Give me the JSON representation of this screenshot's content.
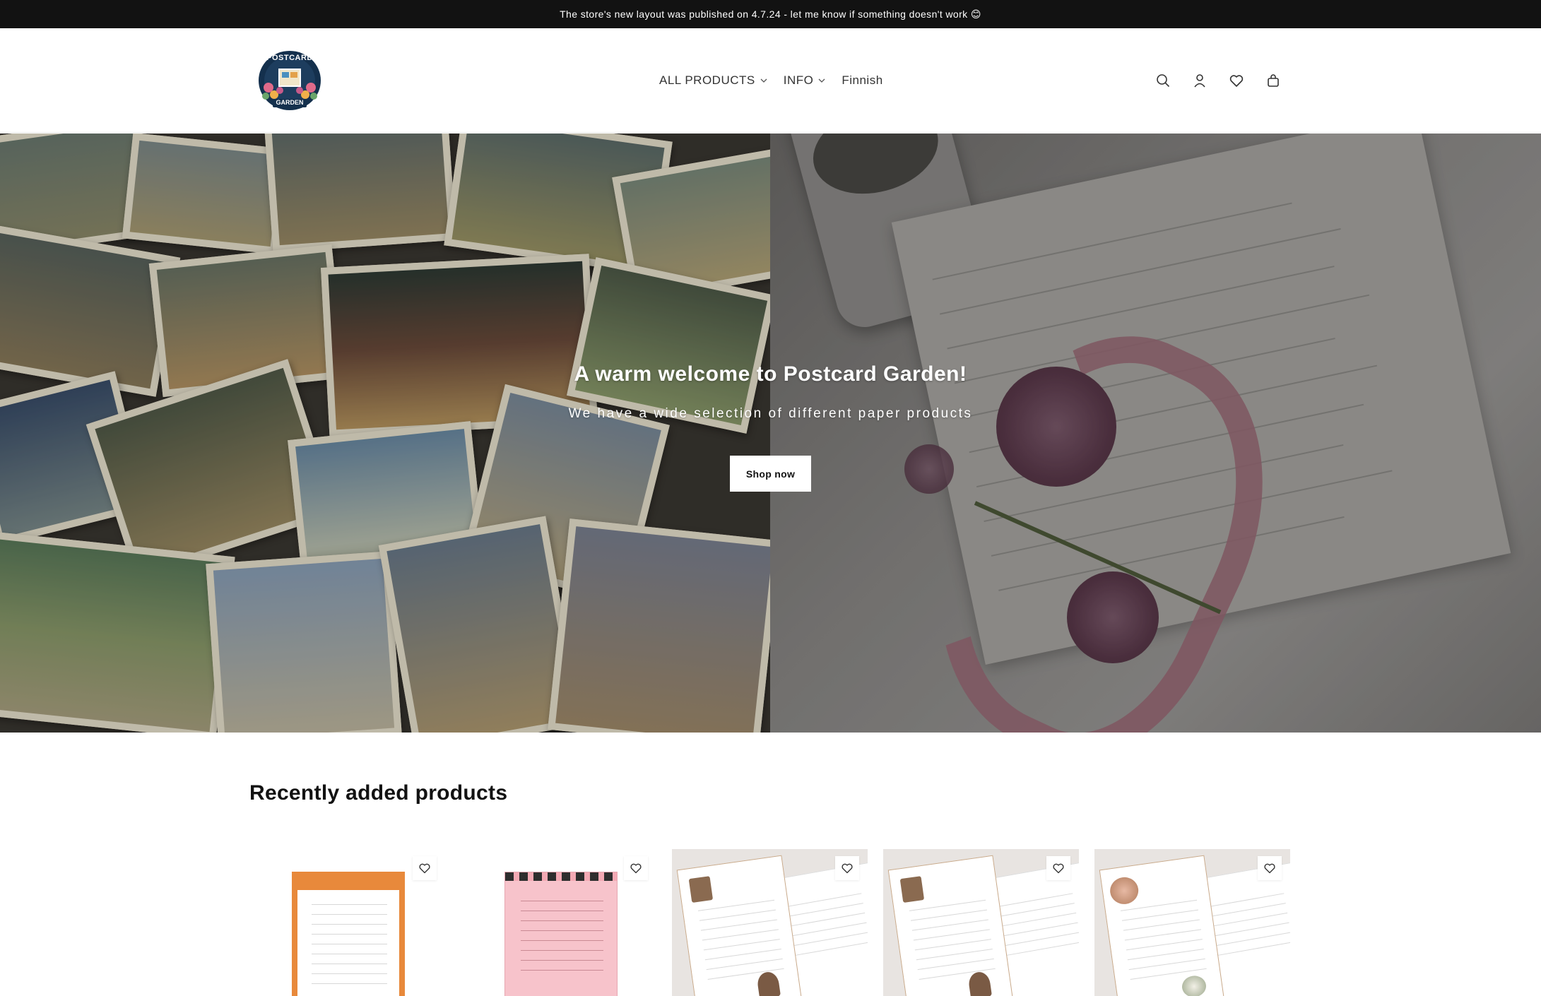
{
  "announcement": {
    "text": "The store's new layout was published on 4.7.24 - let me know if something doesn't work 😊"
  },
  "header": {
    "logo": {
      "text_top": "POSTCARD",
      "text_bottom": "GARDEN"
    },
    "nav": [
      {
        "label": "ALL PRODUCTS",
        "has_dropdown": true
      },
      {
        "label": "INFO",
        "has_dropdown": true
      },
      {
        "label": "Finnish",
        "has_dropdown": false
      }
    ],
    "icons": [
      "search-icon",
      "account-icon",
      "wishlist-icon",
      "cart-icon"
    ]
  },
  "hero": {
    "title": "A warm welcome to Postcard Garden!",
    "subtitle": "We have a wide selection of different paper products",
    "button_label": "Shop now"
  },
  "products": {
    "section_title": "Recently added products",
    "items": [
      {
        "image": "autumn-letter-paper",
        "background": "#ffffff",
        "accent": "#e8893b"
      },
      {
        "image": "halloween-pink-letter-paper",
        "background": "#ffffff",
        "accent": "#f3a9b4"
      },
      {
        "image": "vintage-books-letter-paper",
        "background": "#e8e4e1",
        "accent": "#c7a07a"
      },
      {
        "image": "vintage-books-letter-paper-2",
        "background": "#e8e4e1",
        "accent": "#c7a07a"
      },
      {
        "image": "floral-books-letter-paper",
        "background": "#e8e4e1",
        "accent": "#d89a82"
      }
    ]
  },
  "colors": {
    "announcement_bg": "#121212",
    "text": "#121212",
    "button_bg": "#ffffff"
  }
}
